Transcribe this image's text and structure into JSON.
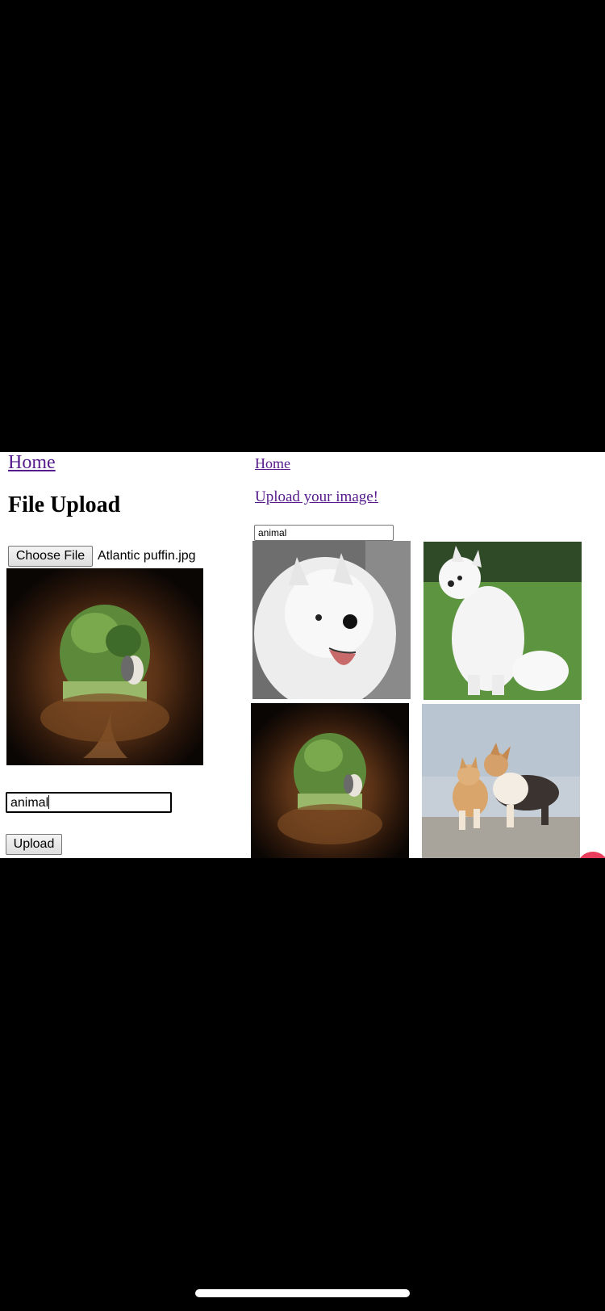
{
  "left_panel": {
    "home_link": "Home",
    "title": "File Upload",
    "choose_file_label": "Choose File",
    "selected_file": "Atlantic puffin.jpg",
    "preview_image": "puffin-in-burrow",
    "tag_input_value": "animal",
    "upload_label": "Upload"
  },
  "right_panel": {
    "home_link": "Home",
    "upload_link": "Upload your image!",
    "search_value": "animal",
    "gallery": [
      {
        "image": "samoyed-face-grayscale"
      },
      {
        "image": "white-spitz-on-grass"
      },
      {
        "image": "puffin-in-burrow"
      },
      {
        "image": "two-corgis-on-beach"
      }
    ]
  },
  "colors": {
    "visited_link": "#551a8b",
    "background_letterbox": "#000000",
    "fab_accent": "#e83e5b"
  }
}
